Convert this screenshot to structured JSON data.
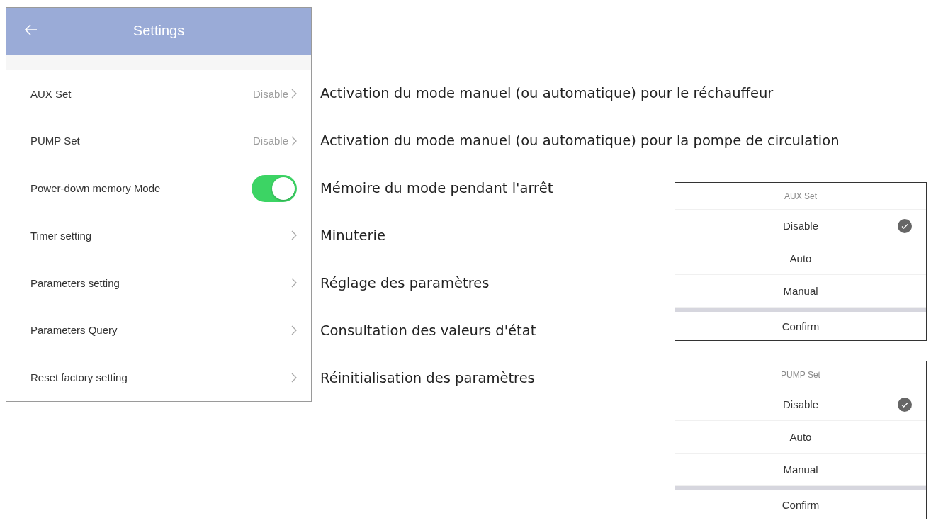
{
  "settings_screen": {
    "header": {
      "title": "Settings"
    },
    "rows": [
      {
        "kind": "value",
        "label": "AUX Set",
        "value": "Disable"
      },
      {
        "kind": "value",
        "label": "PUMP Set",
        "value": "Disable"
      },
      {
        "kind": "toggle",
        "label": "Power-down memory Mode",
        "on": true
      },
      {
        "kind": "link",
        "label": "Timer setting"
      },
      {
        "kind": "link",
        "label": "Parameters setting"
      },
      {
        "kind": "link",
        "label": "Parameters Query"
      },
      {
        "kind": "link",
        "label": "Reset factory setting"
      }
    ]
  },
  "annotations": [
    "Activation du mode manuel (ou automatique) pour le réchauffeur",
    "Activation du mode manuel (ou automatique) pour la pompe de circulation",
    "Mémoire du mode pendant l'arrêt",
    "Minuterie",
    "Réglage des paramètres",
    "Consultation des valeurs d'état",
    "Réinitialisation des paramètres"
  ],
  "pickers": [
    {
      "title": "AUX Set",
      "options": [
        {
          "label": "Disable",
          "selected": true
        },
        {
          "label": "Auto",
          "selected": false
        },
        {
          "label": "Manual",
          "selected": false
        }
      ],
      "confirm": "Confirm"
    },
    {
      "title": "PUMP Set",
      "options": [
        {
          "label": "Disable",
          "selected": true
        },
        {
          "label": "Auto",
          "selected": false
        },
        {
          "label": "Manual",
          "selected": false
        }
      ],
      "confirm": "Confirm"
    }
  ]
}
